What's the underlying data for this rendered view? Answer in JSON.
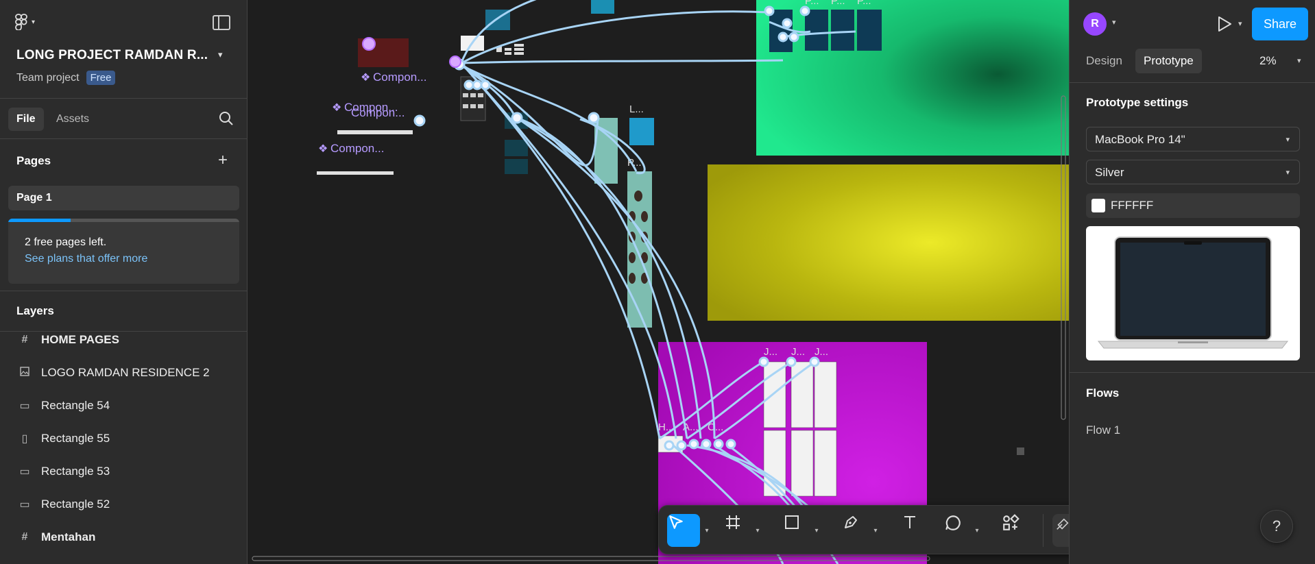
{
  "left_panel": {
    "project_title": "LONG PROJECT RAMDAN R...",
    "team_label": "Team project",
    "plan_badge": "Free",
    "tabs": [
      {
        "label": "File"
      },
      {
        "label": "Assets"
      }
    ],
    "pages_header": "Pages",
    "pages": [
      {
        "label": "Page 1"
      }
    ],
    "upsell": {
      "text": "2 free pages left.",
      "link": "See plans that offer more",
      "progress": 0.27
    },
    "layers_header": "Layers",
    "layers": [
      {
        "label": "HOME PAGES",
        "icon": "frame-icon"
      },
      {
        "label": "LOGO RAMDAN RESIDENCE 2",
        "icon": "image-icon"
      },
      {
        "label": "Rectangle 54",
        "icon": "rectangle-icon"
      },
      {
        "label": "Rectangle 55",
        "icon": "rectangle-vertical-icon"
      },
      {
        "label": "Rectangle 53",
        "icon": "rectangle-icon"
      },
      {
        "label": "Rectangle 52",
        "icon": "rectangle-icon"
      },
      {
        "label": "Mentahan",
        "icon": "frame-icon"
      }
    ]
  },
  "canvas": {
    "component_labels": [
      "Compon...",
      "Compon...",
      "Compon...",
      "Compon..."
    ],
    "frame_labels": [
      "H...",
      "A...",
      "C...",
      "J...",
      "J...",
      "J...",
      "L...",
      "P...",
      "P...",
      "P...",
      "P..."
    ],
    "colors": {
      "green": "#1fe08a",
      "yellow": "#d8dc1c",
      "magenta": "#b312c4",
      "connector": "#a8d4f5"
    }
  },
  "toolbar": {
    "tools": [
      "move-tool",
      "frame-tool",
      "shape-tool",
      "pen-tool",
      "text-tool",
      "comment-tool",
      "actions-tool"
    ],
    "modes": [
      "draw-mode",
      "design-mode",
      "dev-mode"
    ]
  },
  "right_panel": {
    "avatar_initial": "R",
    "share_label": "Share",
    "tabs": [
      {
        "label": "Design"
      },
      {
        "label": "Prototype"
      }
    ],
    "zoom": "2%",
    "prototype_settings_title": "Prototype settings",
    "device": "MacBook Pro 14\"",
    "model": "Silver",
    "background_color": "FFFFFF",
    "flows_title": "Flows",
    "flows": [
      {
        "label": "Flow 1"
      }
    ],
    "help_label": "?"
  },
  "accent": "#0d99ff"
}
